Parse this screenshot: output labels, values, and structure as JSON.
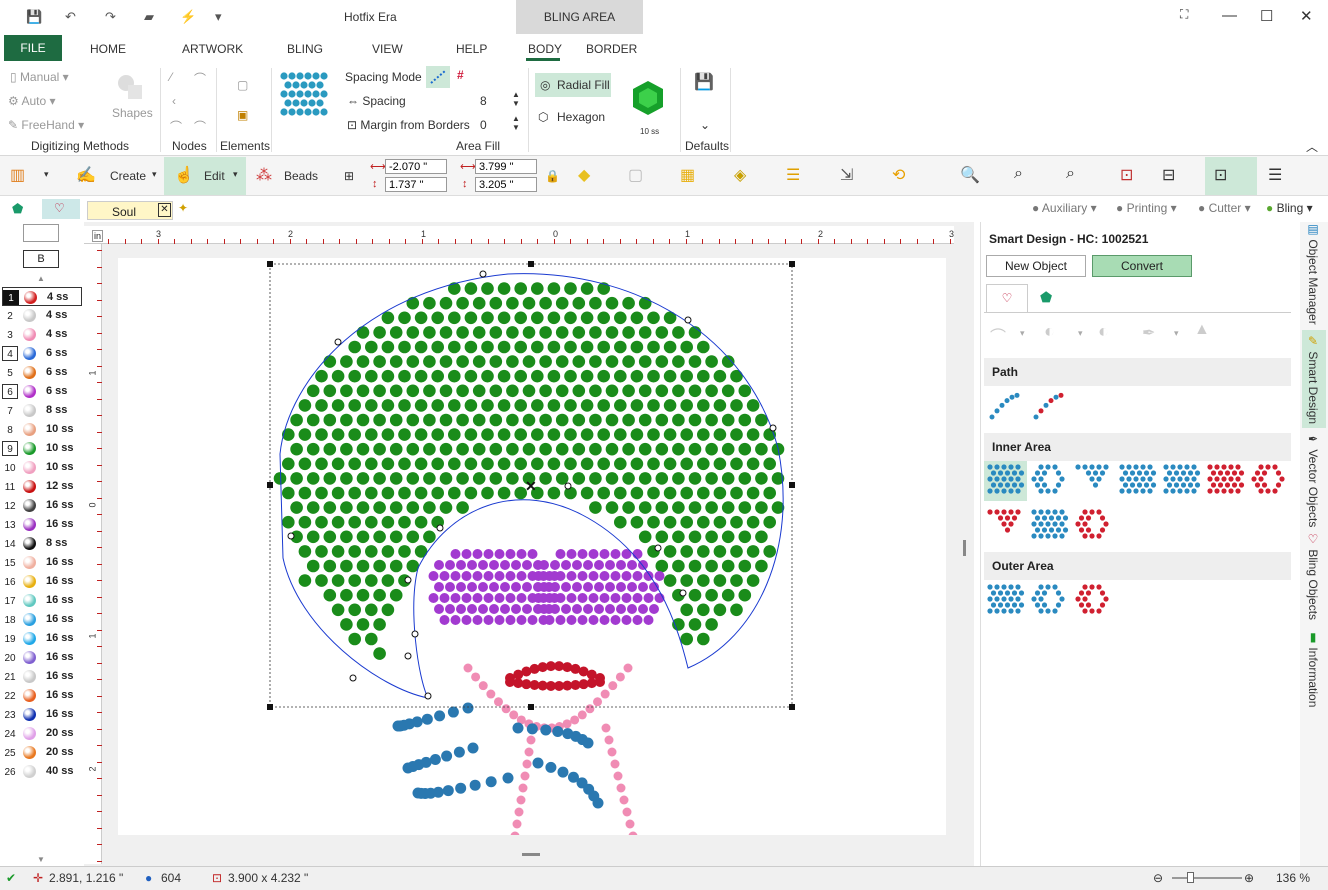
{
  "title": {
    "app": "Hotfix Era",
    "context_tab": "BLING AREA"
  },
  "menu": {
    "file": "FILE",
    "home": "HOME",
    "artwork": "ARTWORK",
    "bling": "BLING",
    "view": "VIEW",
    "help": "HELP",
    "body": "BODY",
    "border": "BORDER"
  },
  "ribbon": {
    "manual": "Manual",
    "auto": "Auto",
    "freehand": "FreeHand",
    "shapes": "Shapes",
    "groups": {
      "digitizing": "Digitizing Methods",
      "nodes": "Nodes",
      "elements": "Elements",
      "area_fill": "Area Fill",
      "defaults": "Defaults"
    },
    "spacing_mode": "Spacing Mode",
    "spacing": "Spacing",
    "spacing_value": "8",
    "margin": "Margin from Borders",
    "margin_value": "0",
    "radial_fill": "Radial Fill",
    "hexagon": "Hexagon",
    "stone_size": "10 ss"
  },
  "toolbar": {
    "create": "Create",
    "edit": "Edit",
    "beads": "Beads",
    "x": "-2.070 \"",
    "y": "1.737 \"",
    "w": "3.799 \"",
    "h": "3.205 \""
  },
  "doc_tab": "Soul",
  "modes": {
    "auxiliary": "Auxiliary",
    "printing": "Printing",
    "cutter": "Cutter",
    "bling": "Bling"
  },
  "left": {
    "b_label": "B",
    "rows": [
      {
        "n": "1",
        "ss": "4 ss",
        "c": "#d21f1f"
      },
      {
        "n": "2",
        "ss": "4 ss",
        "c": "#c8c8c8"
      },
      {
        "n": "3",
        "ss": "4 ss",
        "c": "#f08cb4"
      },
      {
        "n": "4",
        "ss": "6 ss",
        "c": "#2a6ad8"
      },
      {
        "n": "5",
        "ss": "6 ss",
        "c": "#e0701a"
      },
      {
        "n": "6",
        "ss": "6 ss",
        "c": "#b030c8"
      },
      {
        "n": "7",
        "ss": "8 ss",
        "c": "#c8c8c8"
      },
      {
        "n": "8",
        "ss": "10 ss",
        "c": "#e8a080"
      },
      {
        "n": "9",
        "ss": "10 ss",
        "c": "#1a9a2a"
      },
      {
        "n": "10",
        "ss": "10 ss",
        "c": "#f0a0c0"
      },
      {
        "n": "11",
        "ss": "12 ss",
        "c": "#c81010"
      },
      {
        "n": "12",
        "ss": "16 ss",
        "c": "#404040"
      },
      {
        "n": "13",
        "ss": "16 ss",
        "c": "#9a30c0"
      },
      {
        "n": "14",
        "ss": "8 ss",
        "c": "#101010"
      },
      {
        "n": "15",
        "ss": "16 ss",
        "c": "#f0b0a0"
      },
      {
        "n": "16",
        "ss": "16 ss",
        "c": "#e8b010"
      },
      {
        "n": "17",
        "ss": "16 ss",
        "c": "#60c8c0"
      },
      {
        "n": "18",
        "ss": "16 ss",
        "c": "#2aa0e0"
      },
      {
        "n": "19",
        "ss": "16 ss",
        "c": "#20a8e8"
      },
      {
        "n": "20",
        "ss": "16 ss",
        "c": "#8060d0"
      },
      {
        "n": "21",
        "ss": "16 ss",
        "c": "#c8c8c8"
      },
      {
        "n": "22",
        "ss": "16 ss",
        "c": "#e86020"
      },
      {
        "n": "23",
        "ss": "16 ss",
        "c": "#1030b0"
      },
      {
        "n": "24",
        "ss": "20 ss",
        "c": "#e0a0e8"
      },
      {
        "n": "25",
        "ss": "20 ss",
        "c": "#e87820"
      },
      {
        "n": "26",
        "ss": "40 ss",
        "c": "#d0d0d0"
      }
    ]
  },
  "ruler": {
    "in": "in",
    "top": [
      "3",
      "2",
      "1",
      "0",
      "1",
      "2",
      "3"
    ],
    "left": [
      "1",
      "0",
      "1",
      "2"
    ]
  },
  "right": {
    "title": "Smart Design - HC: 1002521",
    "new_object": "New Object",
    "convert": "Convert",
    "sections": {
      "path": "Path",
      "inner": "Inner Area",
      "outer": "Outer Area"
    }
  },
  "vtabs": [
    "Object Manager",
    "Smart Design",
    "Vector Objects",
    "Bling Objects",
    "Information"
  ],
  "status": {
    "coords": "2.891, 1.216 \"",
    "count": "604",
    "size": "3.900 x 4.232 \"",
    "zoom": "136 %"
  },
  "colors": {
    "green": "#1e6b41",
    "hair": "#1a8c1a",
    "glasses": "#a23ad0",
    "lips": "#c4142a",
    "pink": "#f08cb4",
    "blue": "#2a78b0"
  }
}
